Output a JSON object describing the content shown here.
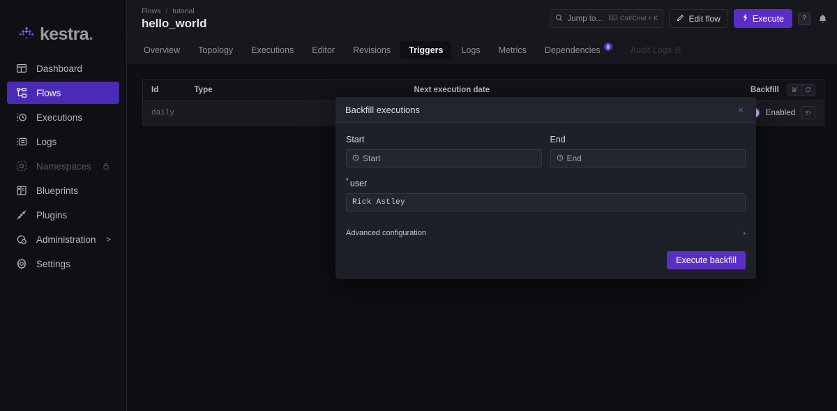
{
  "brand": {
    "name": "kestra",
    "suffix": "."
  },
  "sidebar": {
    "items": [
      {
        "label": "Dashboard",
        "icon": "dashboard-icon",
        "state": "normal"
      },
      {
        "label": "Flows",
        "icon": "flows-icon",
        "state": "active"
      },
      {
        "label": "Executions",
        "icon": "executions-icon",
        "state": "normal"
      },
      {
        "label": "Logs",
        "icon": "logs-icon",
        "state": "normal"
      },
      {
        "label": "Namespaces",
        "icon": "namespaces-icon",
        "state": "muted",
        "lock": true
      },
      {
        "label": "Blueprints",
        "icon": "blueprints-icon",
        "state": "normal"
      },
      {
        "label": "Plugins",
        "icon": "plugins-icon",
        "state": "normal"
      },
      {
        "label": "Administration",
        "icon": "administration-icon",
        "state": "normal",
        "chevron": ">"
      },
      {
        "label": "Settings",
        "icon": "settings-icon",
        "state": "normal"
      }
    ]
  },
  "header": {
    "breadcrumb_root": "Flows",
    "breadcrumb_sep": "/",
    "breadcrumb_namespace": "tutorial",
    "title": "hello_world",
    "search_placeholder": "Jump to...",
    "search_shortcut": "Ctrl/Cmd + K",
    "edit_flow_label": "Edit flow",
    "execute_label": "Execute",
    "help_label": "?"
  },
  "tabs": [
    {
      "label": "Overview",
      "active": false
    },
    {
      "label": "Topology",
      "active": false
    },
    {
      "label": "Executions",
      "active": false
    },
    {
      "label": "Editor",
      "active": false
    },
    {
      "label": "Revisions",
      "active": false
    },
    {
      "label": "Triggers",
      "active": true
    },
    {
      "label": "Logs",
      "active": false
    },
    {
      "label": "Metrics",
      "active": false
    },
    {
      "label": "Dependencies",
      "active": false,
      "badge": "0"
    },
    {
      "label": "Audit Logs",
      "active": false,
      "disabled": true,
      "lock": true
    }
  ],
  "table": {
    "columns": [
      "Id",
      "Type",
      "Next execution date",
      "Backfill"
    ],
    "rows": [
      {
        "id": "daily",
        "type": "",
        "next_execution_date": "",
        "backfill_label": "Backfill executions",
        "enabled_label": "Enabled",
        "enabled": true
      }
    ]
  },
  "modal": {
    "title": "Backfill executions",
    "close_label": "×",
    "start_label": "Start",
    "start_placeholder": "Start",
    "end_label": "End",
    "end_placeholder": "End",
    "user_label": "user",
    "user_required_mark": "*",
    "user_value": "Rick Astley",
    "advanced_label": "Advanced configuration",
    "advanced_chevron": "›",
    "submit_label": "Execute backfill"
  },
  "colors": {
    "accent": "#5b2fc6",
    "accent_active": "#4a2bb5",
    "app_bg": "#0e0f13",
    "panel_bg": "#17181d",
    "modal_bg": "#1e2029",
    "modal_head_bg": "#22242e",
    "close_purple": "#7b4fe0"
  }
}
